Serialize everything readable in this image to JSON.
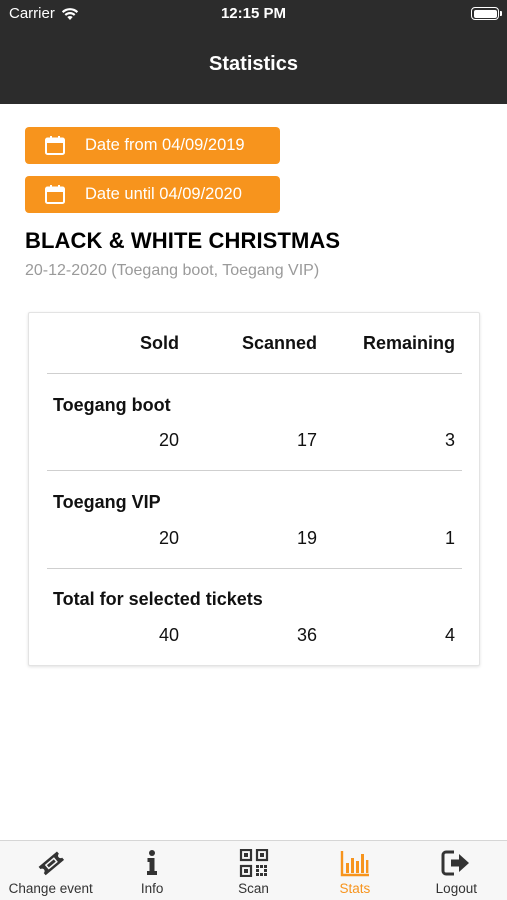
{
  "status_bar": {
    "carrier": "Carrier",
    "time": "12:15 PM"
  },
  "header": {
    "title": "Statistics"
  },
  "filters": {
    "date_from_label": "Date from 04/09/2019",
    "date_until_label": "Date until 04/09/2020"
  },
  "event": {
    "name": "BLACK & WHITE CHRISTMAS",
    "subtitle": "20-12-2020 (Toegang boot, Toegang VIP)"
  },
  "stats_table": {
    "columns": [
      "Sold",
      "Scanned",
      "Remaining"
    ],
    "rows": [
      {
        "name": "Toegang boot",
        "sold": "20",
        "scanned": "17",
        "remaining": "3"
      },
      {
        "name": "Toegang VIP",
        "sold": "20",
        "scanned": "19",
        "remaining": "1"
      },
      {
        "name": "Total for selected tickets",
        "sold": "40",
        "scanned": "36",
        "remaining": "4"
      }
    ]
  },
  "tab_bar": {
    "active": "Stats",
    "active_color": "#f7941d",
    "items": [
      {
        "label": "Change event",
        "icon": "ticket-icon"
      },
      {
        "label": "Info",
        "icon": "info-icon"
      },
      {
        "label": "Scan",
        "icon": "qr-code-icon"
      },
      {
        "label": "Stats",
        "icon": "bar-chart-icon"
      },
      {
        "label": "Logout",
        "icon": "logout-icon"
      }
    ]
  },
  "colors": {
    "accent": "#f7941d",
    "header_bg": "#2c2c2c"
  }
}
